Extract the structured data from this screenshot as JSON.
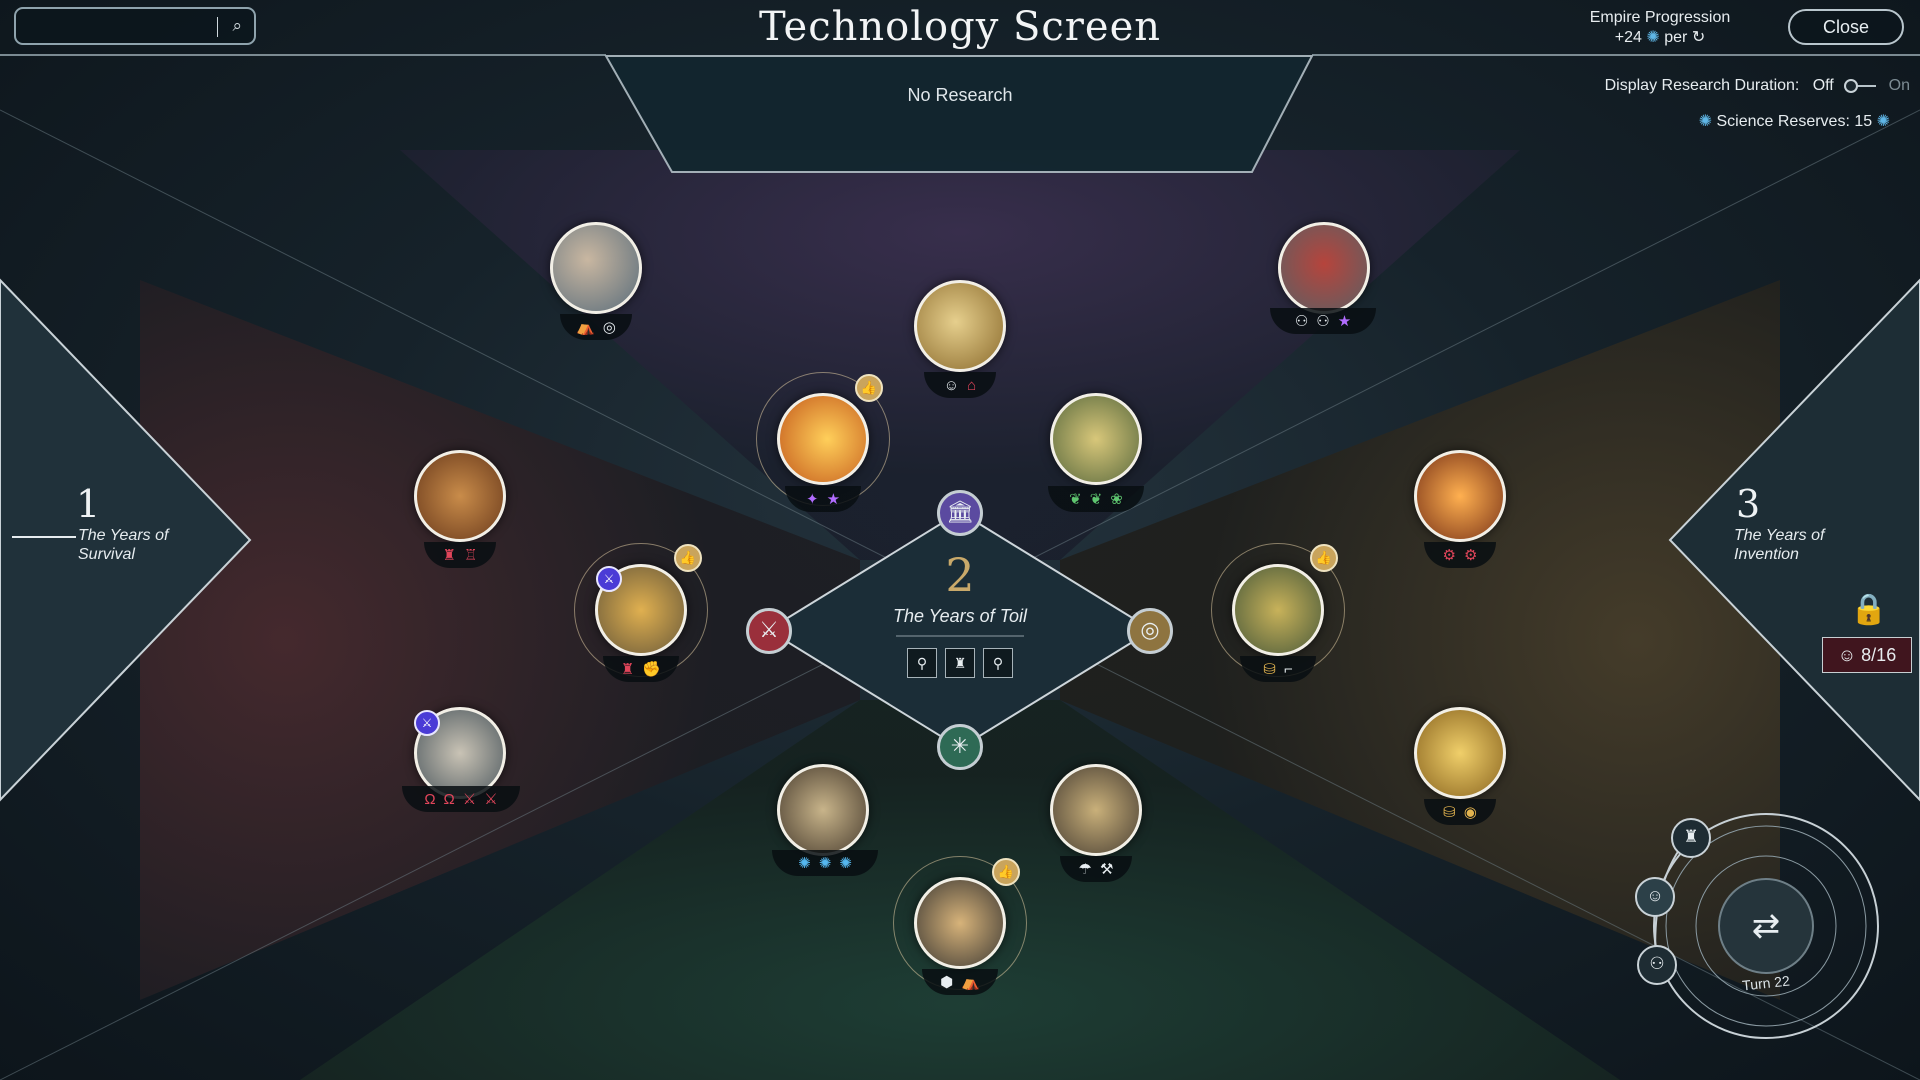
{
  "header": {
    "title": "Technology Screen",
    "research_status": "No Research",
    "close_label": "Close",
    "empire_progression_label": "Empire Progression",
    "empire_progression_rate": "+24",
    "empire_progression_per": "per",
    "display_duration_label": "Display Research Duration:",
    "toggle_off": "Off",
    "toggle_on": "On",
    "science_reserves_label": "Science Reserves: 15"
  },
  "search": {
    "placeholder": ""
  },
  "eras": {
    "left": {
      "number": "1",
      "name": "The Years of Survival"
    },
    "center": {
      "number": "2",
      "name": "The Years of Toil"
    },
    "right": {
      "number": "3",
      "name": "The Years of Invention",
      "requirement": "8/16"
    }
  },
  "turn": {
    "label": "Turn 22"
  },
  "colors": {
    "military": "#e0455a",
    "culture": "#b26cff",
    "food": "#5ec46f",
    "economy": "#e3b44f",
    "science": "#55b8f0",
    "accent": "#c9a96a"
  }
}
